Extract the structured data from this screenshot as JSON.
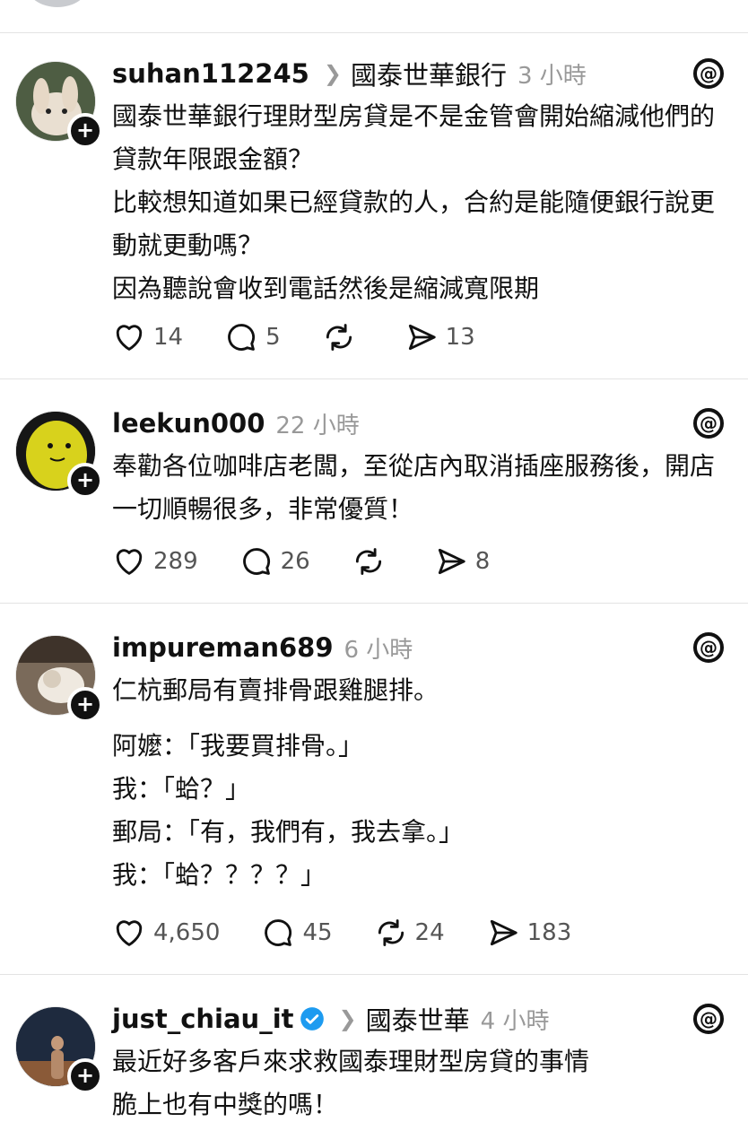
{
  "posts": [
    {
      "username": "suhan112245",
      "community": "國泰世華銀行",
      "time": "3 小時",
      "verified": false,
      "lines": [
        "國泰世華銀行理財型房貸是不是金管會開始縮減他們的貸款年限跟金額？",
        "比較想知道如果已經貸款的人，合約是能隨便銀行說更動就更動嗎？",
        "因為聽說會收到電話然後是縮減寬限期"
      ],
      "likes": "14",
      "comments": "5",
      "reposts": "",
      "shares": "13"
    },
    {
      "username": "leekun000",
      "community": "",
      "time": "22 小時",
      "verified": false,
      "lines": [
        "奉勸各位咖啡店老闆，至從店內取消插座服務後，開店一切順暢很多，非常優質！"
      ],
      "likes": "289",
      "comments": "26",
      "reposts": "",
      "shares": "8"
    },
    {
      "username": "impureman689",
      "community": "",
      "time": "6 小時",
      "verified": false,
      "lines": [
        "仁杭郵局有賣排骨跟雞腿排。",
        "阿嬤：「我要買排骨。」",
        "我：「蛤？」",
        "郵局：「有，我們有，我去拿。」",
        "我：「蛤？？？？」"
      ],
      "likes": "4,650",
      "comments": "45",
      "reposts": "24",
      "shares": "183"
    },
    {
      "username": "just_chiau_it",
      "community": "國泰世華",
      "time": "4 小時",
      "verified": true,
      "lines": [
        "最近好多客戶來求救國泰理財型房貸的事情",
        "脆上也有中獎的嗎！"
      ]
    }
  ],
  "icons": {
    "like": "heart-icon",
    "comment": "comment-icon",
    "repost": "repost-icon",
    "share": "share-icon",
    "threads": "threads-icon",
    "follow": "plus-icon"
  },
  "colors": {
    "text": "#111111",
    "muted": "#999999",
    "count": "#555555",
    "verified": "#1d9bf0",
    "divider": "#e3e3e3"
  }
}
